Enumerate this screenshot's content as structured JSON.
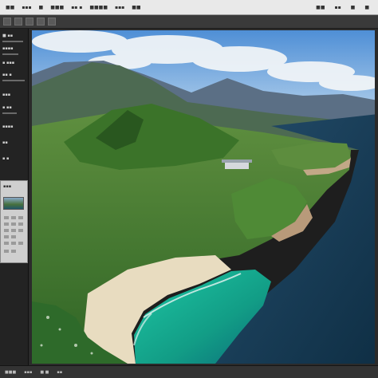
{
  "menubar": {
    "items": [
      "■■",
      "▪▪▪",
      "■",
      "■■■",
      "▪▪ ▪",
      "■■■■",
      "▪▪▪",
      "■■"
    ],
    "right": [
      "■■",
      "▪▪",
      "■",
      "■"
    ]
  },
  "left_panel": {
    "rows": [
      "■ ▪▪",
      "▪▪▪▪",
      "▪ ▪▪▪",
      "▪▪ ▪",
      "▪▪▪",
      "▪ ▪▪",
      "▪▪▪▪",
      "▪▪",
      "▪ ▪"
    ],
    "thumb_header": "▪▪▪"
  },
  "canvas": {
    "image_alt": "Aerial landscape of forested coastal hills, mountains and turquoise bay"
  },
  "status": {
    "items": [
      "■■■",
      "▪▪▪",
      "■ ■",
      "▪▪"
    ]
  },
  "colors": {
    "sky": "#7fb4e6",
    "forest": "#3f7a2e",
    "sea": "#17405c",
    "lagoon": "#15a58d"
  }
}
